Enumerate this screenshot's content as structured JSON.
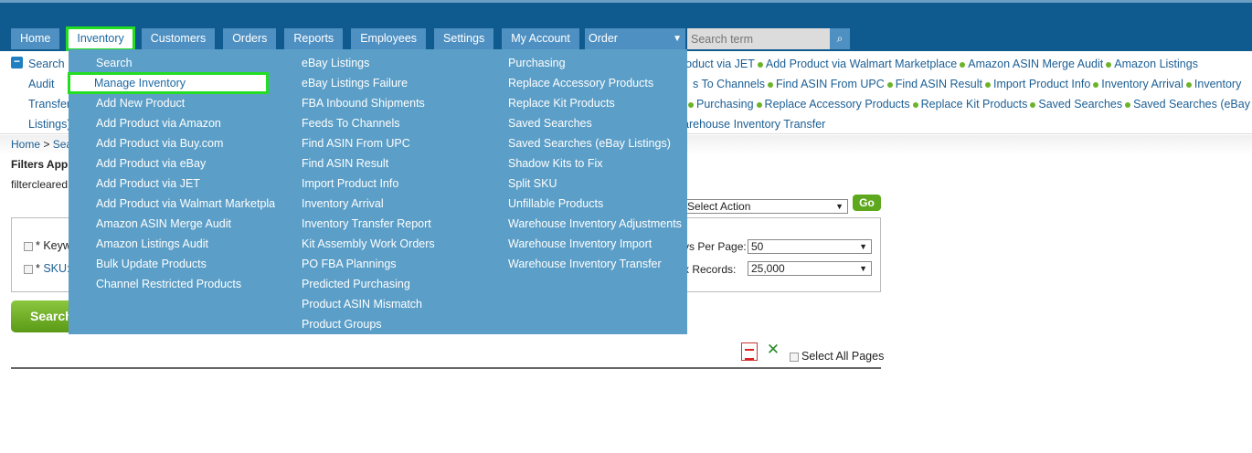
{
  "nav": {
    "tabs": [
      "Home",
      "Inventory",
      "Customers",
      "Orders",
      "Reports",
      "Employees",
      "Settings",
      "My Account"
    ],
    "active": "Inventory",
    "order_select": "Order",
    "search_placeholder": "Search term"
  },
  "quick_links": {
    "row1_left": "Search",
    "row1_right": [
      "roduct via JET",
      "Add Product via Walmart Marketplace",
      "Amazon ASIN Merge Audit",
      "Amazon Listings"
    ],
    "row2_left": "Audit",
    "row2_right": [
      "s To Channels",
      "Find ASIN From UPC",
      "Find ASIN Result",
      "Import Product Info",
      "Inventory Arrival",
      "Inventory"
    ],
    "row3_left": "Transfer",
    "row3_right": [
      "Purchasing",
      "Replace Accessory Products",
      "Replace Kit Products",
      "Saved Searches",
      "Saved Searches (eBay"
    ],
    "row4_left": "Listings)",
    "row4_right": "arehouse Inventory Transfer"
  },
  "breadcrumb": {
    "home": "Home",
    "sep": ">",
    "current": "Sea"
  },
  "filters": {
    "applied_label": "Filters App",
    "cleared_text": "filtercleared",
    "keyword_label": "* Keyw",
    "sku_prefix": "* ",
    "sku_label": "SKU:",
    "rows_per_page_label": "vs Per Page:",
    "rows_per_page_value": "50",
    "max_records_label": "x Records:",
    "max_records_value": "25,000",
    "action_select": "Select Action",
    "go_label": "Go",
    "search_button": "Search"
  },
  "export": {
    "select_all_label": "Select All Pages"
  },
  "dropdown": {
    "col1": [
      "Search",
      "Manage Inventory",
      "Add New Product",
      "Add Product via Amazon",
      "Add Product via Buy.com",
      "Add Product via eBay",
      "Add Product via JET",
      "Add Product via Walmart Marketplace",
      "Amazon ASIN Merge Audit",
      "Amazon Listings Audit",
      "Bulk Update Products",
      "Channel Restricted Products"
    ],
    "col2": [
      "eBay Listings",
      "eBay Listings Failure",
      "FBA Inbound Shipments",
      "Feeds To Channels",
      "Find ASIN From UPC",
      "Find ASIN Result",
      "Import Product Info",
      "Inventory Arrival",
      "Inventory Transfer Report",
      "Kit Assembly Work Orders",
      "PO FBA Plannings",
      "Predicted Purchasing",
      "Product ASIN Mismatch",
      "Product Groups"
    ],
    "col3": [
      "Purchasing",
      "Replace Accessory Products",
      "Replace Kit Products",
      "Saved Searches",
      "Saved Searches (eBay Listings)",
      "Shadow Kits to Fix",
      "Split SKU",
      "Unfillable Products",
      "Warehouse Inventory Adjustments",
      "Warehouse Inventory Import",
      "Warehouse Inventory Transfer"
    ],
    "highlighted": "Manage Inventory"
  },
  "icons": {
    "collapse": "minus-square-icon",
    "search": "magnifier-icon",
    "pdf": "pdf-icon",
    "excel": "excel-icon"
  }
}
